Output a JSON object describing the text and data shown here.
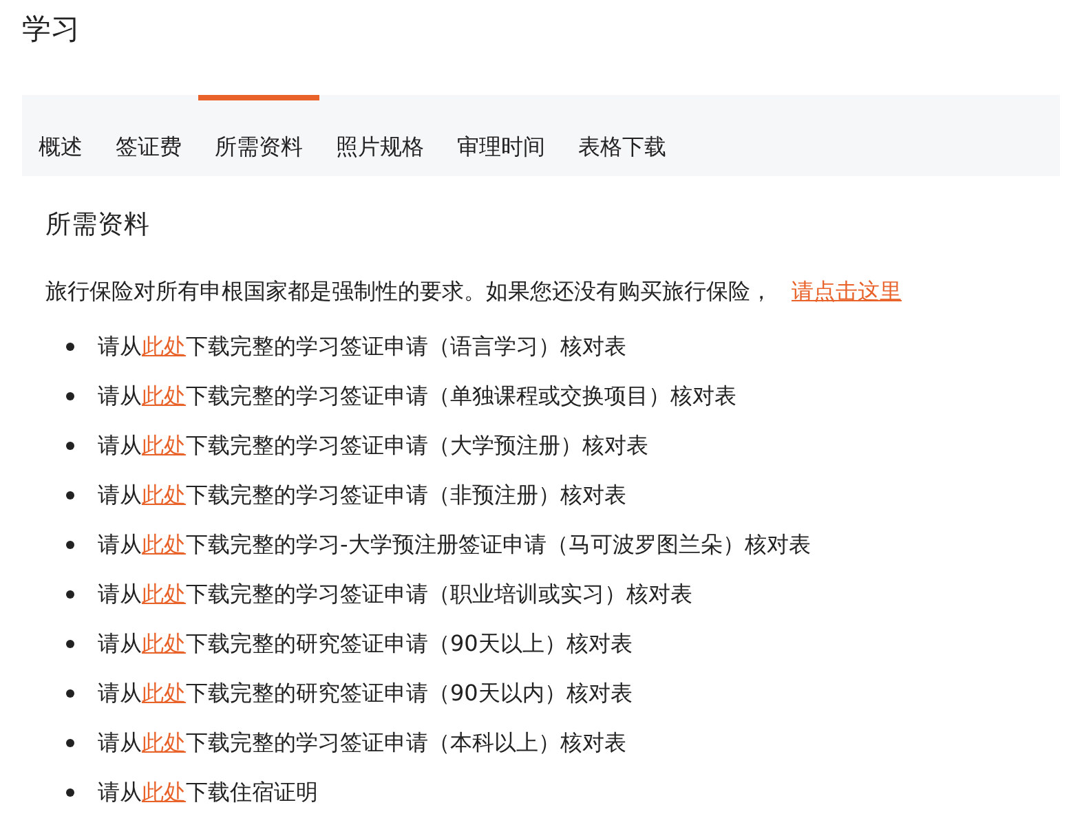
{
  "page_title": "学习",
  "tabs": [
    {
      "label": "概述",
      "selected": false
    },
    {
      "label": "签证费",
      "selected": false
    },
    {
      "label": "所需资料",
      "selected": true
    },
    {
      "label": "照片规格",
      "selected": false
    },
    {
      "label": "审理时间",
      "selected": false
    },
    {
      "label": "表格下载",
      "selected": false
    }
  ],
  "section_title": "所需资料",
  "intro": {
    "text": "旅行保险对所有申根国家都是强制性的要求。如果您还没有购买旅行保险，",
    "link": "请点击这里"
  },
  "items": [
    {
      "before": "请从",
      "link": "此处",
      "after": "下载完整的学习签证申请（语言学习）核对表"
    },
    {
      "before": "请从",
      "link": "此处",
      "after": "下载完整的学习签证申请（单独课程或交换项目）核对表"
    },
    {
      "before": "请从",
      "link": "此处",
      "after": "下载完整的学习签证申请（大学预注册）核对表"
    },
    {
      "before": "请从",
      "link": "此处",
      "after": "下载完整的学习签证申请（非预注册）核对表"
    },
    {
      "before": "请从",
      "link": "此处",
      "after": "下载完整的学习-大学预注册签证申请（马可波罗图兰朵）核对表"
    },
    {
      "before": "请从",
      "link": "此处",
      "after": "下载完整的学习签证申请（职业培训或实习）核对表"
    },
    {
      "before": "请从",
      "link": "此处",
      "after": "下载完整的研究签证申请（90天以上）核对表"
    },
    {
      "before": "请从",
      "link": "此处",
      "after": "下载完整的研究签证申请（90天以内）核对表"
    },
    {
      "before": "请从",
      "link": "此处",
      "after": "下载完整的学习签证申请（本科以上）核对表"
    },
    {
      "before": "请从",
      "link": "此处",
      "after": "下载住宿证明"
    }
  ]
}
